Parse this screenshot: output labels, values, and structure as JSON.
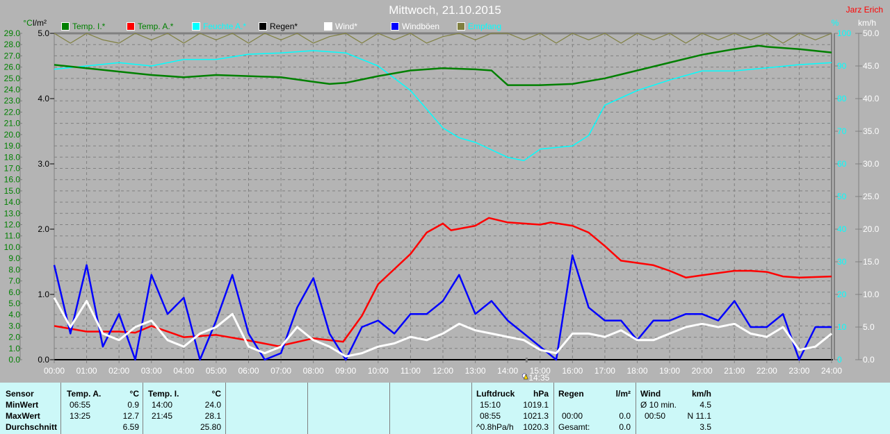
{
  "header": {
    "title": "Mittwoch, 21.10.2015",
    "author": "Jarz Erich"
  },
  "chart_data": {
    "type": "line",
    "title": "Mittwoch, 21.10.2015",
    "x_labels": [
      "00:00",
      "01:00",
      "02:00",
      "03:00",
      "04:00",
      "05:00",
      "06:00",
      "07:00",
      "08:00",
      "09:00",
      "10:00",
      "11:00",
      "12:00",
      "13:00",
      "14:00",
      "15:00",
      "16:00",
      "17:00",
      "18:00",
      "19:00",
      "20:00",
      "21:00",
      "22:00",
      "23:00",
      "24:00"
    ],
    "x_unit": "hours",
    "xlim": [
      0,
      24
    ],
    "grid": true,
    "legend_placement": "top",
    "axes": {
      "temp": {
        "label": "°C",
        "ylim": [
          0,
          29
        ],
        "step": 1,
        "color": "#008000"
      },
      "rain": {
        "label": "l/m²",
        "ylim": [
          0,
          5
        ],
        "step": 1,
        "color": "#000000"
      },
      "humidity": {
        "label": "%",
        "ylim": [
          0,
          100
        ],
        "step": 10,
        "color": "#00ffff"
      },
      "wind": {
        "label": "km/h",
        "ylim": [
          0,
          50
        ],
        "step": 5,
        "color": "#ffffff"
      }
    },
    "legend": [
      {
        "name": "Temp. I.*",
        "color": "#008000",
        "text_color": "#008000"
      },
      {
        "name": "Temp. A.*",
        "color": "#ff0000",
        "text_color": "#008000"
      },
      {
        "name": "Feuchte A.*",
        "color": "#00ffff",
        "text_color": "#00ffff"
      },
      {
        "name": "Regen*",
        "color": "#000000",
        "text_color": "#000000"
      },
      {
        "name": "Wind*",
        "color": "#ffffff",
        "text_color": "#ffffff"
      },
      {
        "name": "Windböen",
        "color": "#0000ff",
        "text_color": "#ffffff"
      },
      {
        "name": "Empfang",
        "color": "#808040",
        "text_color": "#00ffff"
      }
    ],
    "series": [
      {
        "name": "Temp. I.*",
        "axis": "temp",
        "color": "#008000",
        "x": [
          0,
          1,
          2,
          3,
          4,
          5,
          6,
          7,
          8,
          8.5,
          9,
          10,
          11,
          12,
          13,
          13.5,
          14,
          15,
          16,
          17,
          18,
          19,
          20,
          21,
          21.75,
          22,
          23,
          24
        ],
        "y": [
          26.2,
          25.9,
          25.6,
          25.3,
          25.1,
          25.3,
          25.2,
          25.1,
          24.7,
          24.5,
          24.6,
          25.2,
          25.7,
          25.9,
          25.8,
          25.7,
          24.4,
          24.4,
          24.5,
          25.0,
          25.7,
          26.4,
          27.1,
          27.6,
          27.9,
          27.8,
          27.6,
          27.3
        ]
      },
      {
        "name": "Temp. A.*",
        "axis": "temp",
        "color": "#ff0000",
        "x": [
          0,
          1,
          2,
          2.5,
          3,
          4,
          5,
          6,
          6.92,
          8,
          8.92,
          9.5,
          10,
          11,
          11.5,
          12,
          12.25,
          13,
          13.42,
          14,
          15,
          15.33,
          16,
          16.5,
          17,
          17.5,
          18,
          18.5,
          19,
          19.5,
          20,
          21,
          21.5,
          22,
          22.5,
          23,
          24
        ],
        "y": [
          3.0,
          2.5,
          2.5,
          2.4,
          3.0,
          2.0,
          2.2,
          1.7,
          1.2,
          1.9,
          1.6,
          3.9,
          6.7,
          9.4,
          11.3,
          12.1,
          11.5,
          11.9,
          12.6,
          12.2,
          12.0,
          12.2,
          11.9,
          11.3,
          10.1,
          8.8,
          8.6,
          8.4,
          7.9,
          7.3,
          7.5,
          7.9,
          7.9,
          7.8,
          7.4,
          7.3,
          7.4
        ]
      },
      {
        "name": "Feuchte A.*",
        "axis": "humidity",
        "color": "#00ffff",
        "x": [
          0,
          1,
          2,
          3,
          4,
          5,
          6,
          7,
          8,
          9,
          10,
          11,
          12,
          12.5,
          13,
          14,
          14.5,
          15,
          16,
          16.5,
          17,
          18,
          19,
          20,
          21,
          22,
          23,
          24
        ],
        "y": [
          89,
          90,
          91,
          90,
          92,
          92,
          93.6,
          94,
          94.7,
          94,
          90,
          82.5,
          71,
          68,
          66.6,
          62,
          61,
          64.5,
          65.5,
          68.7,
          78,
          82.5,
          85.7,
          88.5,
          88.5,
          89.4,
          90.4,
          91
        ]
      },
      {
        "name": "Wind*",
        "axis": "wind",
        "color": "#ffffff",
        "x": [
          0,
          0.5,
          1,
          1.5,
          2,
          2.5,
          3,
          3.5,
          4,
          4.5,
          5,
          5.5,
          6,
          6.5,
          7,
          7.5,
          8,
          8.5,
          9,
          9.5,
          10,
          10.5,
          11,
          11.5,
          12,
          12.5,
          13,
          13.5,
          14,
          14.5,
          15,
          15.5,
          16,
          16.5,
          17,
          17.5,
          18,
          18.5,
          19,
          19.5,
          20,
          20.5,
          21,
          21.5,
          22,
          22.5,
          23,
          23.5,
          24
        ],
        "y": [
          9.5,
          5,
          9,
          4,
          3,
          5,
          6,
          3,
          2,
          4,
          5,
          7,
          2,
          1,
          2,
          5,
          3,
          2,
          0.5,
          1,
          2,
          2.5,
          3.5,
          3,
          4,
          5.5,
          4.5,
          4,
          3.5,
          3,
          1.5,
          1,
          4,
          4,
          3.5,
          4.5,
          3,
          3,
          4,
          5,
          5.5,
          5,
          5.5,
          4,
          3.5,
          5,
          1.5,
          2,
          4
        ]
      },
      {
        "name": "Windböen",
        "axis": "wind",
        "color": "#0000ff",
        "x": [
          0,
          0.5,
          1,
          1.5,
          2,
          2.5,
          3,
          3.5,
          4,
          4.5,
          5,
          5.5,
          6,
          6.5,
          7,
          7.5,
          8,
          8.5,
          9,
          9.5,
          10,
          10.5,
          11,
          11.5,
          12,
          12.5,
          13,
          13.5,
          14,
          14.5,
          15,
          15.5,
          16,
          16.5,
          17,
          17.5,
          18,
          18.5,
          19,
          19.5,
          20,
          20.5,
          21,
          21.5,
          22,
          22.5,
          23,
          23.5,
          24
        ],
        "y": [
          14.5,
          4,
          14.5,
          2,
          7,
          0,
          13,
          7,
          9.5,
          0,
          6,
          13,
          4,
          0,
          1,
          8,
          12.5,
          4,
          0,
          5,
          6,
          4,
          7,
          7,
          9,
          13,
          7,
          9,
          6,
          4,
          2,
          0,
          16,
          8,
          6,
          6,
          3,
          6,
          6,
          7,
          7,
          6,
          9,
          5,
          5,
          7,
          0,
          5,
          5
        ]
      },
      {
        "name": "Empfang",
        "axis": "humidity",
        "color": "#808040",
        "x": [
          0,
          0.5,
          1,
          1.5,
          2,
          2.5,
          3,
          3.5,
          4,
          4.5,
          5,
          5.5,
          6,
          6.5,
          7,
          7.5,
          8,
          8.5,
          9,
          9.5,
          10,
          10.5,
          11,
          11.5,
          12,
          12.5,
          13,
          13.5,
          14,
          14.5,
          15,
          15.5,
          16,
          16.5,
          17,
          17.5,
          18,
          18.5,
          19,
          19.5,
          20,
          20.5,
          21,
          21.5,
          22,
          22.5,
          23,
          23.5,
          24
        ],
        "y": [
          100,
          97,
          100,
          98,
          97,
          100,
          98,
          100,
          97,
          100,
          98,
          100,
          97,
          100,
          98,
          100,
          97,
          99,
          100,
          97,
          100,
          98,
          100,
          97,
          99,
          100,
          98,
          100,
          100,
          98,
          100,
          97,
          100,
          98,
          100,
          97,
          100,
          98,
          100,
          97,
          100,
          98,
          100,
          98,
          100,
          97,
          100,
          98,
          100
        ]
      },
      {
        "name": "Regen*",
        "axis": "rain",
        "color": "#000000",
        "x": [
          0,
          24
        ],
        "y": [
          0,
          0
        ]
      }
    ],
    "current_time_marker": "14:35"
  },
  "stats": {
    "headers": {
      "sensor": "Sensor",
      "temp_a": "Temp. A.",
      "temp_a_unit": "°C",
      "temp_i": "Temp. I.",
      "temp_i_unit": "°C",
      "pressure": "Luftdruck",
      "pressure_unit": "hPa",
      "rain": "Regen",
      "rain_unit": "l/m²",
      "wind": "Wind",
      "wind_unit": "km/h"
    },
    "rows": {
      "min": "MinWert",
      "max": "MaxWert",
      "avg": "Durchschnitt"
    },
    "temp_a": {
      "min_time": "06:55",
      "min": "0.9",
      "max_time": "13:25",
      "max": "12.7",
      "avg": "6.59"
    },
    "temp_i": {
      "min_time": "14:00",
      "min": "24.0",
      "max_time": "21:45",
      "max": "28.1",
      "avg": "25.80"
    },
    "pressure": {
      "r1_label": "15:10",
      "r1": "1019.1",
      "r2_label": "08:55",
      "r2": "1021.3",
      "r3_label": "^0.8hPa/h",
      "r3": "1020.3"
    },
    "rain": {
      "r2_label": "00:00",
      "r2": "0.0",
      "r3_label": "Gesamt:",
      "r3": "0.0"
    },
    "wind": {
      "r1_label": "Ø 10 min.",
      "r1": "4.5",
      "r2_label": "00:50",
      "r2": "N 11.1",
      "r3": "3.5"
    }
  }
}
